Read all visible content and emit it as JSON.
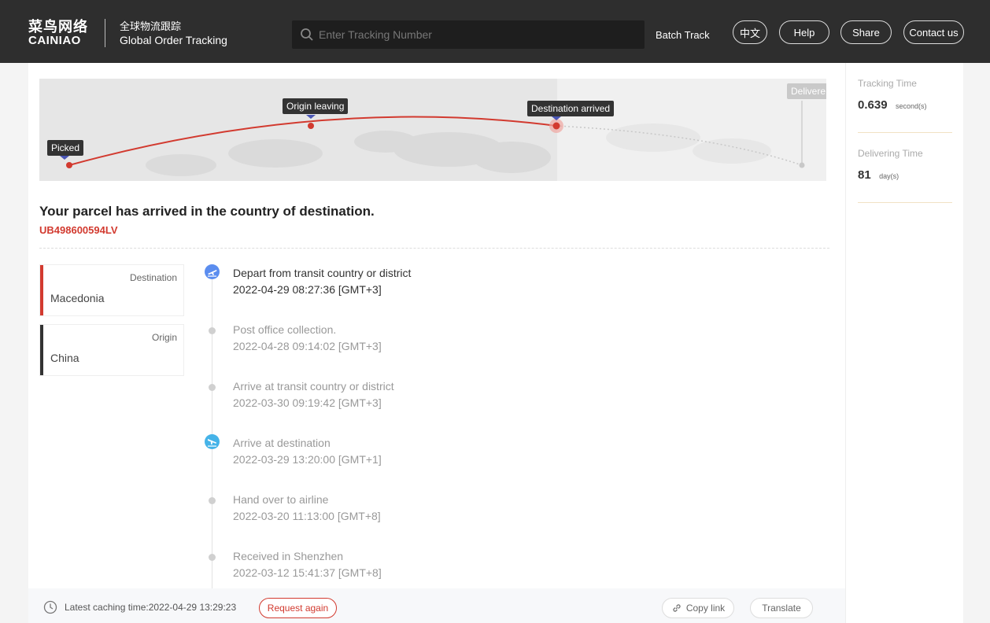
{
  "header": {
    "logo_cn": "菜鸟网络",
    "logo_en": "CAINIAO",
    "brand_cn": "全球物流跟踪",
    "brand_en": "Global Order Tracking",
    "search_placeholder": "Enter Tracking Number",
    "batch_label": "Batch Track",
    "lang_label": "中文",
    "help_label": "Help",
    "share_label": "Share",
    "contact_label": "Contact us"
  },
  "progress": {
    "picked": "Picked",
    "origin_leaving": "Origin leaving",
    "destination_arrived": "Destination arrived",
    "delivered": "Delivere"
  },
  "status": {
    "headline": "Your parcel has arrived in the country of destination.",
    "tracking_number": "UB498600594LV"
  },
  "locations": {
    "destination_label": "Destination",
    "destination_value": "Macedonia",
    "origin_label": "Origin",
    "origin_value": "China"
  },
  "events": [
    {
      "title": "Depart from transit country or district",
      "time": "2022-04-29 08:27:36 [GMT+3]"
    },
    {
      "title": "Post office collection.",
      "time": "2022-04-28 09:14:02 [GMT+3]"
    },
    {
      "title": "Arrive at transit country or district",
      "time": "2022-03-30 09:19:42 [GMT+3]"
    },
    {
      "title": "Arrive at destination",
      "time": "2022-03-29 13:20:00 [GMT+1]"
    },
    {
      "title": "Hand over to airline",
      "time": "2022-03-20 11:13:00 [GMT+8]"
    },
    {
      "title": "Received in Shenzhen",
      "time": "2022-03-12 15:41:37 [GMT+8]"
    }
  ],
  "footer": {
    "caching_text": "Latest caching time:2022-04-29 13:29:23",
    "request_label": "Request again",
    "copy_label": "Copy link",
    "translate_label": "Translate"
  },
  "side": {
    "tracking_label": "Tracking Time",
    "tracking_value": "0.639",
    "tracking_unit": "second(s)",
    "delivering_label": "Delivering Time",
    "delivering_value": "81",
    "delivering_unit": "day(s)"
  },
  "colors": {
    "accent_red": "#d23a2f",
    "topbar": "#2e2e2e",
    "origin_bar": "#333333",
    "plane_blue": "#5b8def",
    "plane_cyan": "#45b3e8"
  }
}
